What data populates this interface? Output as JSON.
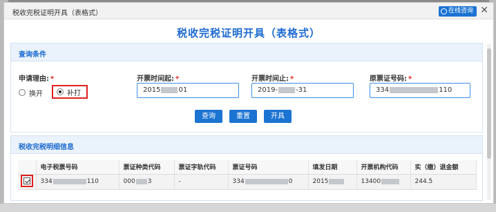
{
  "dialog": {
    "title": "税收完税证明开具（表格式）",
    "consult_label": "在线咨询",
    "close_label": "✕",
    "page_title": "税收完税证明开具（表格式）"
  },
  "query": {
    "section_title": "查询条件",
    "reason_label": "申请理由:",
    "req_mark": "*",
    "options": [
      "换开",
      "补打"
    ],
    "selected_option": "补打",
    "start_label": "开票时间起:",
    "start_value_pre": "2015",
    "start_value_post": "01",
    "end_label": "开票时间止:",
    "end_value_pre": "2019-",
    "end_value_post": "-31",
    "orig_label": "原票证号码:",
    "orig_value_pre": "334",
    "orig_value_post": "110",
    "buttons": [
      "查询",
      "重置",
      "开具"
    ]
  },
  "detail": {
    "section_title": "税收完税明细信息",
    "columns": [
      "电子税票号码",
      "票证种类代码",
      "票证字轨代码",
      "票证号码",
      "填发日期",
      "开票机构代码",
      "实（缴）退金额"
    ],
    "row": {
      "checked": true,
      "e_tax_pre": "334",
      "e_tax_post": "110",
      "kind_code_pre": "000",
      "kind_code_post": "3",
      "track_code": "-",
      "ticket_no_pre": "334",
      "ticket_no_post": "0",
      "issue_date": "2015",
      "org_code_pre": "13400",
      "amount": "244.5"
    }
  },
  "colors": {
    "accent": "#1d6ad2",
    "button": "#1b73d2",
    "highlight": "#e02020"
  }
}
